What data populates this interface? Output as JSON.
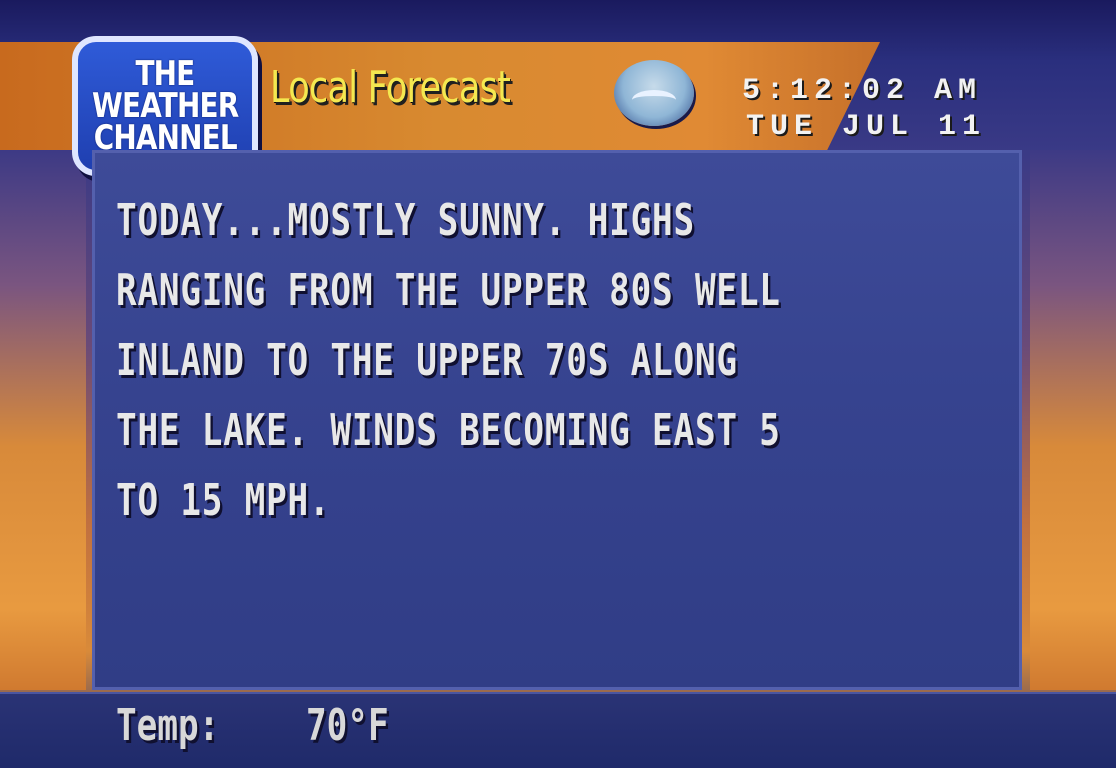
{
  "logo": {
    "lines": [
      "THE",
      "WEATHER",
      "CHANNEL"
    ]
  },
  "header": {
    "title": "Local Forecast",
    "time": "5:12:02 AM",
    "date": "TUE JUL 11",
    "emblem_icon": "noaa-logo-icon"
  },
  "forecast": {
    "lines": [
      "TODAY...MOSTLY SUNNY. HIGHS",
      "RANGING FROM THE UPPER 80S WELL",
      "INLAND TO THE UPPER 70S ALONG",
      "THE LAKE. WINDS BECOMING EAST 5",
      "TO 15 MPH."
    ]
  },
  "footer": {
    "temp_label": "Temp:",
    "temp_value": "70°F"
  },
  "colors": {
    "panel": "#36438f",
    "title_yellow": "#f4e850",
    "logo_blue": "#1f3fb0",
    "orange": "#d88a30"
  }
}
